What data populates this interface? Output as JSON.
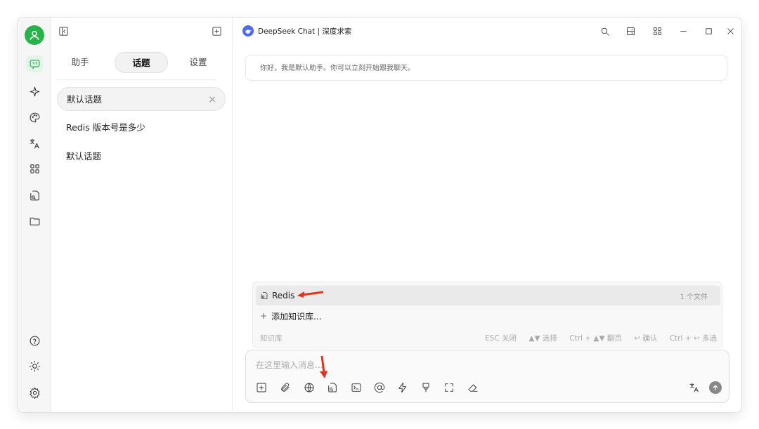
{
  "sidebar": {
    "items": [
      {
        "name": "chat",
        "icon": "chat-bubble-icon"
      },
      {
        "name": "agents",
        "icon": "sparkle-icon"
      },
      {
        "name": "paintings",
        "icon": "palette-icon"
      },
      {
        "name": "translate",
        "icon": "translate-icon"
      },
      {
        "name": "apps",
        "icon": "grid-icon"
      },
      {
        "name": "knowledge",
        "icon": "knowledge-base-icon"
      },
      {
        "name": "files",
        "icon": "folder-icon"
      }
    ],
    "bottom": [
      {
        "name": "help",
        "icon": "help-circle-icon"
      },
      {
        "name": "theme",
        "icon": "sun-icon"
      },
      {
        "name": "settings",
        "icon": "gear-icon"
      }
    ]
  },
  "topics_panel": {
    "tabs": [
      {
        "label": "助手",
        "active": false
      },
      {
        "label": "话题",
        "active": true
      },
      {
        "label": "设置",
        "active": false
      }
    ],
    "topics": [
      {
        "label": "默认话题",
        "active": true
      },
      {
        "label": "Redis 版本号是多少",
        "active": false
      },
      {
        "label": "默认话题",
        "active": false
      }
    ],
    "close_glyph": "×"
  },
  "titlebar": {
    "title": "DeepSeek Chat | 深度求索"
  },
  "chat": {
    "greeting": "你好，我是默认助手。你可以立刻开始跟我聊天。"
  },
  "kb_popup": {
    "items": [
      {
        "label": "Redis",
        "count": "1 个文件",
        "selected": true
      }
    ],
    "add_label": "添加知识库...",
    "footer_label": "知识库",
    "hints": [
      "ESC 关闭",
      "▲▼ 选择",
      "Ctrl + ▲▼ 翻页",
      "↩ 确认",
      "Ctrl + ↩ 多选"
    ]
  },
  "input": {
    "placeholder": "在这里输入消息..."
  },
  "colors": {
    "accent": "#1f9d45",
    "avatar": "#27b24c",
    "annotation_arrow": "#e0341c",
    "logo": "#4e6cf1"
  }
}
